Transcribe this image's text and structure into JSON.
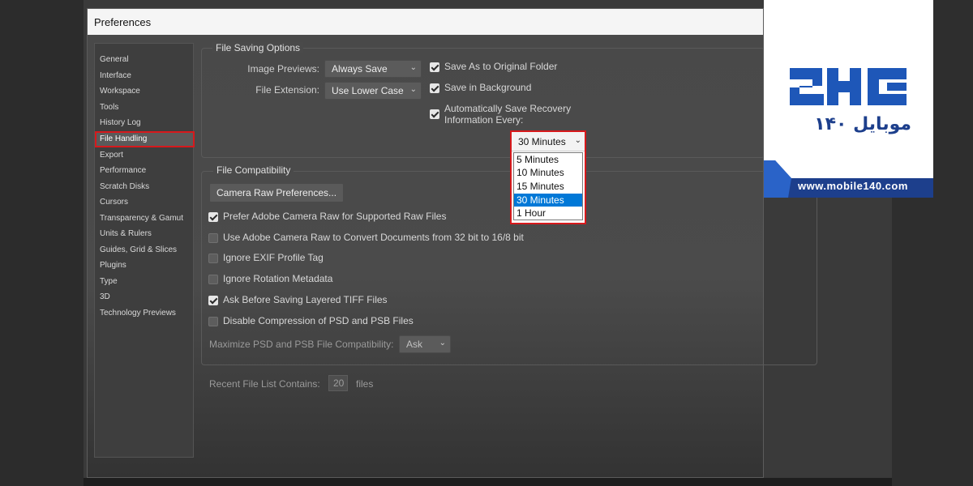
{
  "window": {
    "title": "Preferences"
  },
  "sidebar": {
    "items": [
      {
        "label": "General"
      },
      {
        "label": "Interface"
      },
      {
        "label": "Workspace"
      },
      {
        "label": "Tools"
      },
      {
        "label": "History Log"
      },
      {
        "label": "File Handling",
        "active": true
      },
      {
        "label": "Export"
      },
      {
        "label": "Performance"
      },
      {
        "label": "Scratch Disks"
      },
      {
        "label": "Cursors"
      },
      {
        "label": "Transparency & Gamut"
      },
      {
        "label": "Units & Rulers"
      },
      {
        "label": "Guides, Grid & Slices"
      },
      {
        "label": "Plugins"
      },
      {
        "label": "Type"
      },
      {
        "label": "3D"
      },
      {
        "label": "Technology Previews"
      }
    ]
  },
  "file_saving": {
    "title": "File Saving Options",
    "image_previews_label": "Image Previews:",
    "image_previews_value": "Always Save",
    "file_extension_label": "File Extension:",
    "file_extension_value": "Use Lower Case",
    "save_as_original_label": "Save As to Original Folder",
    "save_as_original_checked": true,
    "save_in_background_label": "Save in Background",
    "save_in_background_checked": true,
    "auto_save_label_line1": "Automatically Save Recovery",
    "auto_save_label_line2": "Information Every:",
    "auto_save_checked": true,
    "auto_save_interval": {
      "selected": "30 Minutes",
      "options": [
        "5 Minutes",
        "10 Minutes",
        "15 Minutes",
        "30 Minutes",
        "1 Hour"
      ]
    }
  },
  "file_compat": {
    "title": "File Compatibility",
    "camera_raw_button": "Camera Raw Preferences...",
    "options": [
      {
        "label": "Prefer Adobe Camera Raw for Supported Raw Files",
        "checked": true
      },
      {
        "label": "Use Adobe Camera Raw to Convert Documents from 32 bit to 16/8 bit",
        "checked": false
      },
      {
        "label": "Ignore EXIF Profile Tag",
        "checked": false
      },
      {
        "label": "Ignore Rotation Metadata",
        "checked": false
      },
      {
        "label": "Ask Before Saving Layered TIFF Files",
        "checked": true
      },
      {
        "label": "Disable Compression of PSD and PSB Files",
        "checked": false
      }
    ],
    "maximize_label": "Maximize PSD and PSB File Compatibility:",
    "maximize_value": "Ask"
  },
  "recent_files": {
    "label": "Recent File List Contains:",
    "value": "20",
    "suffix": "files"
  },
  "watermark": {
    "brand_persian": "موبایل ۱۴۰",
    "url": "www.mobile140.com",
    "colors": {
      "brand_blue": "#1e57b8",
      "band_dark": "#1d3f8c"
    }
  }
}
